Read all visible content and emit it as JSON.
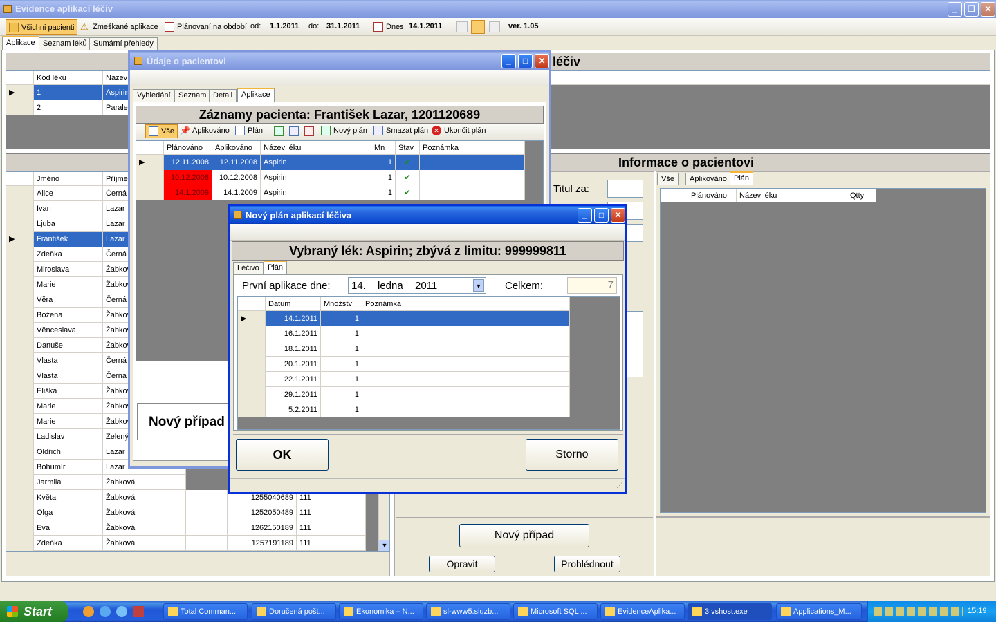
{
  "app": {
    "title": "Evidence aplikací léčiv",
    "toolbar": {
      "all_patients": "Všichni pacienti",
      "missed": "Zmeškané aplikace",
      "planning_label": "Plánovaní na období",
      "from_label": "od:",
      "from_value": "1.1.2011",
      "to_label": "do:",
      "to_value": "31.1.2011",
      "today_label": "Dnes",
      "today_value": "14.1.2011",
      "version": "ver. 1.05"
    },
    "tabs": [
      "Aplikace",
      "Seznam léků",
      "Sumární přehledy"
    ]
  },
  "drug_grid": {
    "section_title_tail": "léčiv",
    "headers": [
      "Kód léku",
      "Název"
    ],
    "rows": [
      {
        "code": "1",
        "name": "Aspirin"
      },
      {
        "code": "2",
        "name": "Paralen"
      }
    ]
  },
  "patient_grid": {
    "headers": [
      "Jméno",
      "Příjme"
    ],
    "rows": [
      {
        "first": "Alice",
        "last": "Černá"
      },
      {
        "first": "Ivan",
        "last": "Lazar"
      },
      {
        "first": "Ljuba",
        "last": "Lazar"
      },
      {
        "first": "František",
        "last": "Lazar"
      },
      {
        "first": "Zdeňka",
        "last": "Černá"
      },
      {
        "first": "Miroslava",
        "last": "Žabkov"
      },
      {
        "first": "Marie",
        "last": "Žabkov"
      },
      {
        "first": "Věra",
        "last": "Černá"
      },
      {
        "first": "Božena",
        "last": "Žabkov"
      },
      {
        "first": "Věnceslava",
        "last": "Žabkov"
      },
      {
        "first": "Danuše",
        "last": "Žabkov"
      },
      {
        "first": "Vlasta",
        "last": "Černá"
      },
      {
        "first": "Vlasta",
        "last": "Černá"
      },
      {
        "first": "Eliška",
        "last": "Žabkov"
      },
      {
        "first": "Marie",
        "last": "Žabkov"
      },
      {
        "first": "Marie",
        "last": "Žabkov"
      },
      {
        "first": "Ladislav",
        "last": "Zelený"
      },
      {
        "first": "Oldřich",
        "last": "Lazar"
      },
      {
        "first": "Bohumír",
        "last": "Lazar"
      },
      {
        "first": "Jarmila",
        "last": "Žabková"
      },
      {
        "first": "Květa",
        "last": "Žabková",
        "id": "1255040689",
        "code": "111"
      },
      {
        "first": "Olga",
        "last": "Žabková",
        "id": "1252050489",
        "code": "111"
      },
      {
        "first": "Eva",
        "last": "Žabková",
        "id": "1262150189",
        "code": "111"
      },
      {
        "first": "Zdeňka",
        "last": "Žabková",
        "id": "1257191189",
        "code": "111"
      }
    ]
  },
  "patient_info": {
    "title": "Informace o pacientovi",
    "titul_label": "Titul za:",
    "tabs": [
      "Vše",
      "Aplikováno",
      "Plán"
    ],
    "grid_headers": [
      "Plánováno",
      "Název léku",
      "Qtty"
    ],
    "new_case": "Nový případ",
    "edit": "Opravit",
    "view": "Prohlédnout"
  },
  "patient_dialog": {
    "title": "Údaje o pacientovi",
    "tabs": [
      "Vyhledání",
      "Seznam",
      "Detail",
      "Aplikace"
    ],
    "records_title": "Záznamy pacienta: František Lazar, 1201120689",
    "toolbar": [
      "Vše",
      "Aplikováno",
      "Plán",
      "Nový plán",
      "Smazat plán",
      "Ukončit plán"
    ],
    "headers": [
      "Plánováno",
      "Aplikováno",
      "Název léku",
      "Mn",
      "Stav",
      "Poznámka"
    ],
    "rows": [
      {
        "planned": "12.11.2008",
        "applied": "12.11.2008",
        "drug": "Aspirin",
        "qty": "1"
      },
      {
        "planned": "10.12.2008",
        "applied": "10.12.2008",
        "drug": "Aspirin",
        "qty": "1"
      },
      {
        "planned": "14.1.2009",
        "applied": "14.1.2009",
        "drug": "Aspirin",
        "qty": "1"
      }
    ],
    "new_case": "Nový případ"
  },
  "plan_dialog": {
    "title": "Nový plán aplikací léčiva",
    "header": "Vybraný lék: Aspirin;  zbývá z limitu: 999999811",
    "tabs": [
      "Léčivo",
      "Plán"
    ],
    "first_app_label": "První aplikace dne:",
    "date_day": "14.",
    "date_month": "ledna",
    "date_year": "2011",
    "total_label": "Celkem:",
    "total_value": "7",
    "headers": [
      "Datum",
      "Množství",
      "Poznámka"
    ],
    "rows": [
      {
        "date": "14.1.2011",
        "qty": "1"
      },
      {
        "date": "16.1.2011",
        "qty": "1"
      },
      {
        "date": "18.1.2011",
        "qty": "1"
      },
      {
        "date": "20.1.2011",
        "qty": "1"
      },
      {
        "date": "22.1.2011",
        "qty": "1"
      },
      {
        "date": "29.1.2011",
        "qty": "1"
      },
      {
        "date": "5.2.2011",
        "qty": "1"
      }
    ],
    "ok": "OK",
    "cancel": "Storno"
  },
  "taskbar": {
    "start": "Start",
    "tasks": [
      "Total Comman...",
      "Doručená pošt...",
      "Ekonomika – N...",
      "sl-www5.sluzb...",
      "Microsoft SQL ...",
      "EvidenceAplika...",
      "3 vshost.exe",
      "Applications_M..."
    ],
    "clock": "15:19"
  },
  "colors": {
    "selection": "#316ac5",
    "overdue": "#ff0000",
    "title_active": "#0a4bd0"
  }
}
